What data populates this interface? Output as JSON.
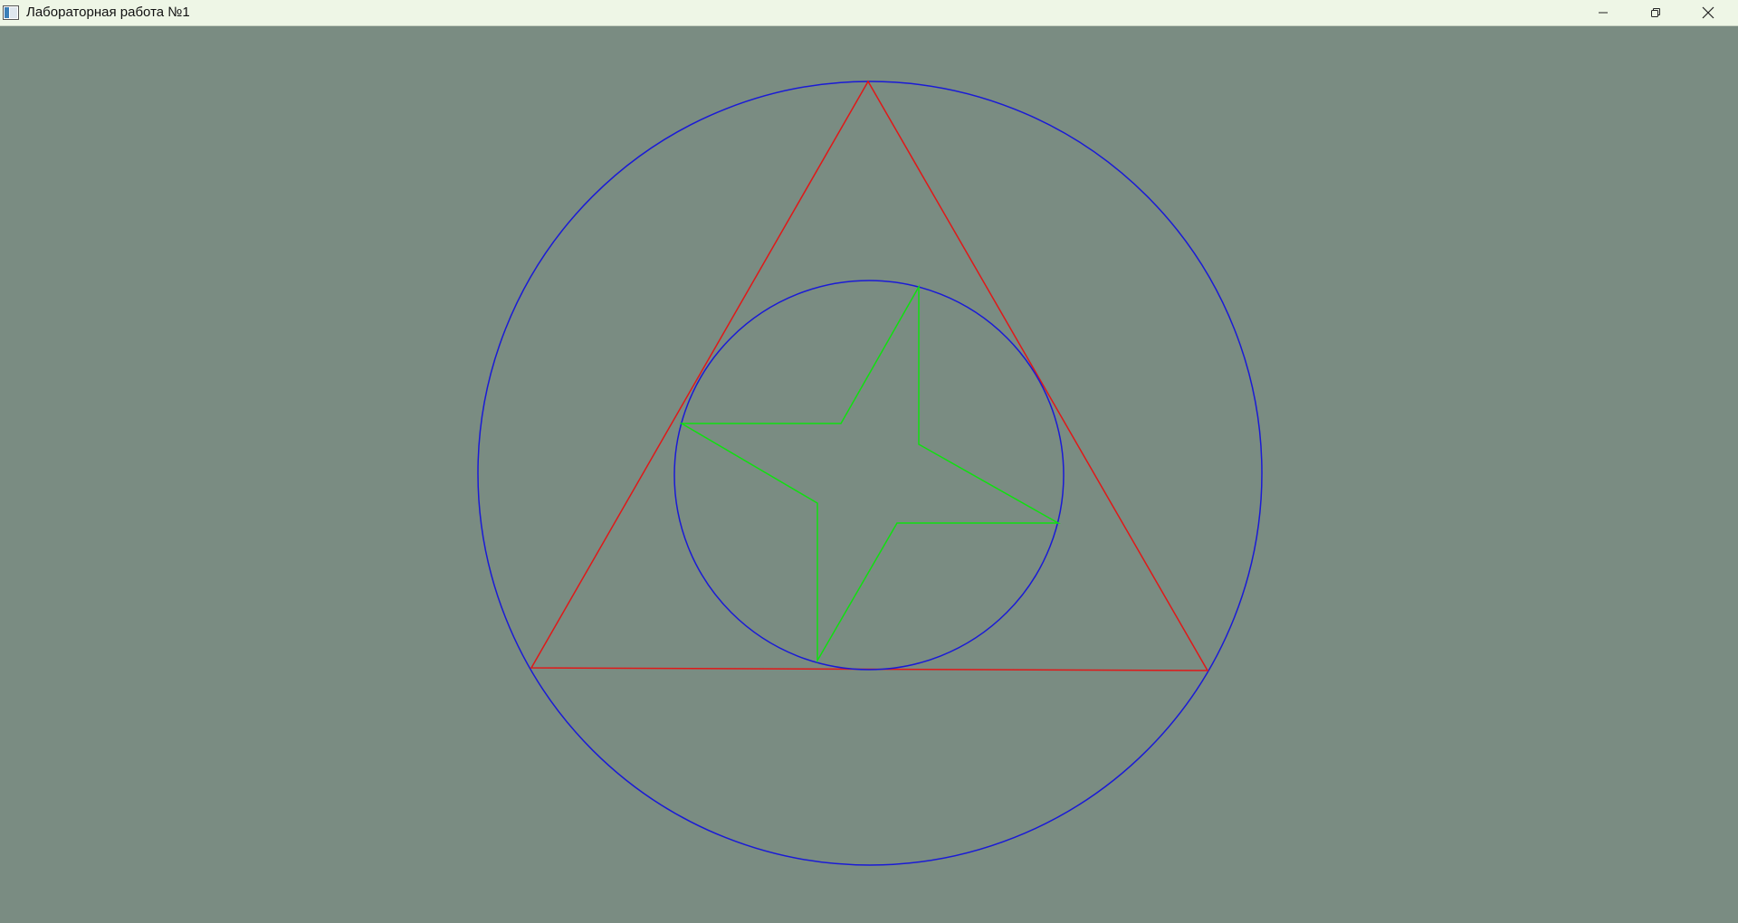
{
  "window": {
    "title": "Лабораторная работа №1",
    "app_icon": "app-window-icon",
    "controls": {
      "minimize_icon": "minimize-icon",
      "restore_icon": "restore-icon",
      "close_icon": "close-icon"
    }
  },
  "canvas": {
    "background_color": "#7a8c82",
    "shapes": [
      {
        "kind": "circle",
        "name": "outer-circle",
        "color": "#1a1ad6"
      },
      {
        "kind": "triangle",
        "name": "triangle",
        "color": "#e01818"
      },
      {
        "kind": "circle",
        "name": "inner-circle",
        "color": "#1a1ad6"
      },
      {
        "kind": "star",
        "name": "four-point-star",
        "color": "#10e010"
      }
    ]
  }
}
